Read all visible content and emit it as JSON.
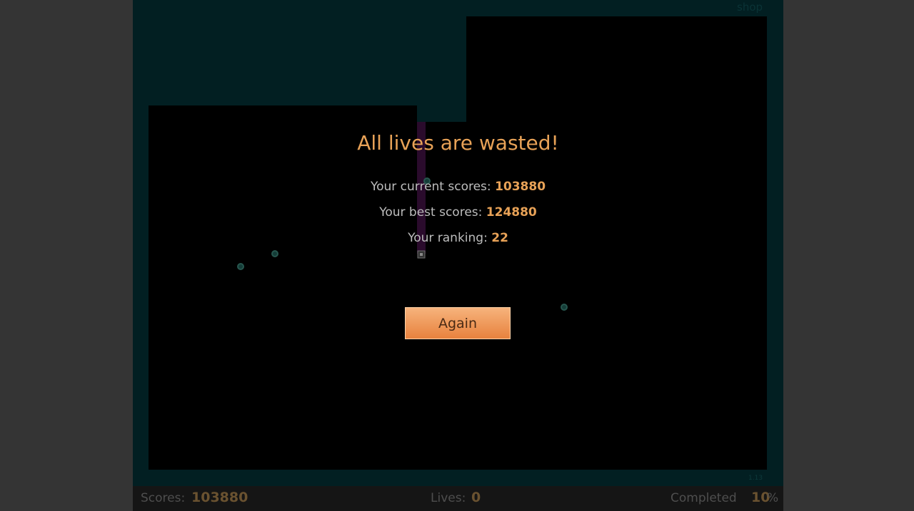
{
  "top": {
    "shop_label": "shop"
  },
  "footer": {
    "version": "1.13"
  },
  "game_over": {
    "title": "All lives are wasted!",
    "current_scores_label": "Your current scores:",
    "current_scores_value": "103880",
    "best_scores_label": "Your best scores:",
    "best_scores_value": "124880",
    "ranking_label": "Your ranking:",
    "ranking_value": "22",
    "again_label": "Again"
  },
  "status_bar": {
    "scores_label": "Scores:",
    "scores_value": "103880",
    "lives_label": "Lives:",
    "lives_value": "0",
    "completed_label": "Completed",
    "completed_value": "10",
    "completed_unit": "%"
  },
  "colors": {
    "background": "#343434",
    "captured_area": "#021f22",
    "unclaimed_area": "#000000",
    "accent": "#e8a257",
    "button": "#ee9a58",
    "trail": "#2d0a2e",
    "enemy": "#143d38"
  },
  "icons": {
    "enemy": "enemy-ball-icon",
    "player": "player-cursor-icon"
  }
}
